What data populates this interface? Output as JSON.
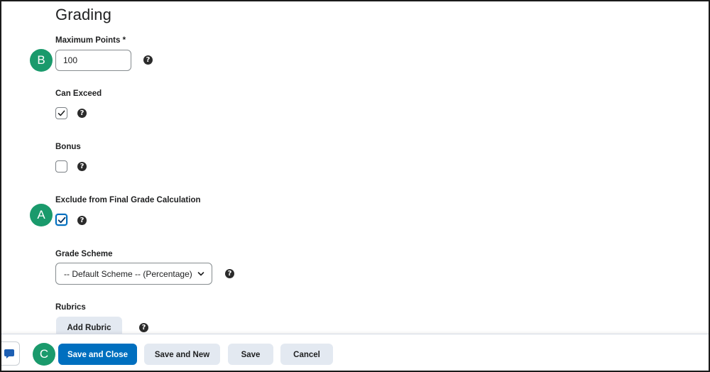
{
  "section": {
    "title": "Grading"
  },
  "max_points": {
    "label": "Maximum Points *",
    "value": "100"
  },
  "can_exceed": {
    "label": "Can Exceed",
    "checked": true
  },
  "bonus": {
    "label": "Bonus",
    "checked": false
  },
  "exclude_final": {
    "label": "Exclude from Final Grade Calculation",
    "checked": true
  },
  "grade_scheme": {
    "label": "Grade Scheme",
    "selected": "-- Default Scheme -- (Percentage)"
  },
  "rubrics": {
    "label": "Rubrics",
    "add_label": "Add Rubric"
  },
  "footer": {
    "save_close": "Save and Close",
    "save_new": "Save and New",
    "save": "Save",
    "cancel": "Cancel"
  },
  "markers": {
    "a": "A",
    "b": "B",
    "c": "C"
  },
  "help_glyph": "?",
  "colors": {
    "primary": "#006fbf",
    "marker": "#1a9a6c",
    "secondary_button": "#e3e9f1"
  },
  "icons": [
    "help-icon",
    "checkmark-icon",
    "chevron-down-icon",
    "chat-icon"
  ]
}
